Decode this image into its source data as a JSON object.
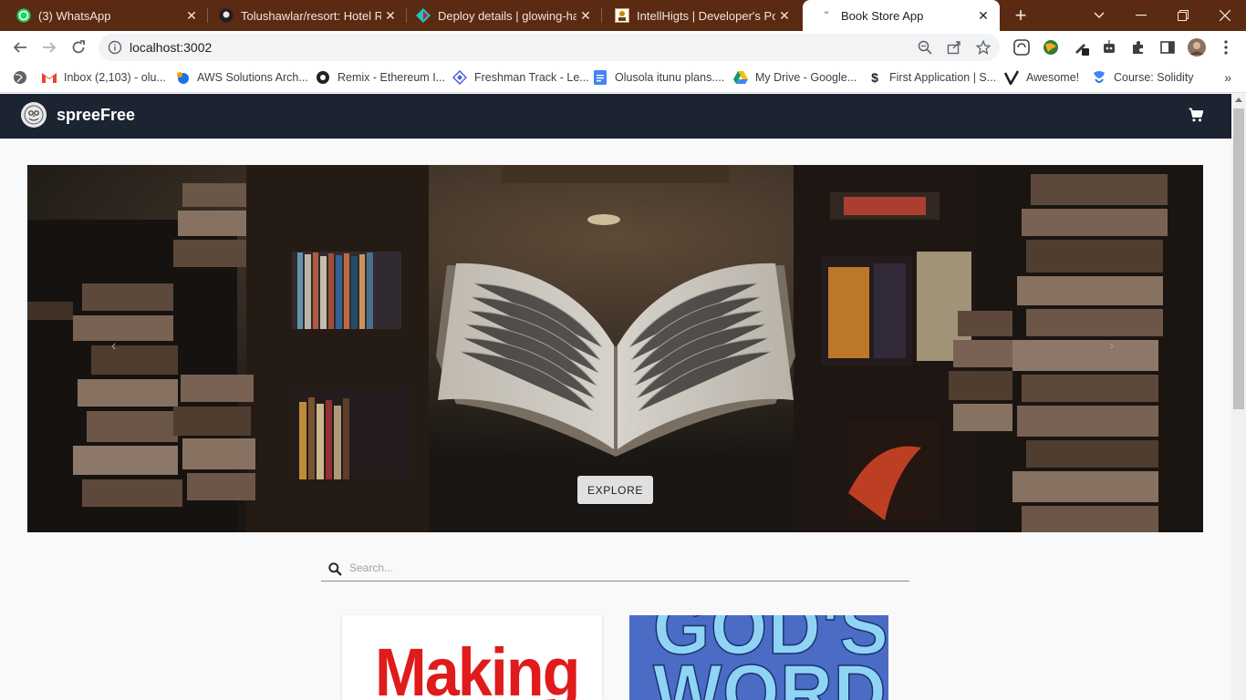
{
  "browser": {
    "tabs": [
      {
        "title": "(3) WhatsApp",
        "icon": "whatsapp-icon"
      },
      {
        "title": "Tolushawlar/resort: Hotel Res",
        "icon": "github-icon"
      },
      {
        "title": "Deploy details | glowing-hau",
        "icon": "netlify-icon"
      },
      {
        "title": "IntellHigts | Developer's Port",
        "icon": "portfolio-icon"
      },
      {
        "title": "Book Store App",
        "icon": "quote-icon",
        "active": true
      }
    ],
    "url": "localhost:3002",
    "bookmarks": [
      {
        "label": "Inbox (2,103) - olu...",
        "icon": "gmail-icon"
      },
      {
        "label": "AWS Solutions Arch...",
        "icon": "aws-icon"
      },
      {
        "label": "Remix - Ethereum I...",
        "icon": "remix-icon"
      },
      {
        "label": "Freshman Track - Le...",
        "icon": "freshman-icon"
      },
      {
        "label": "Olusola itunu plans....",
        "icon": "docs-icon"
      },
      {
        "label": "My Drive - Google...",
        "icon": "drive-icon"
      },
      {
        "label": "First Application | S...",
        "icon": "dollar-icon"
      },
      {
        "label": "Awesome!",
        "icon": "check-icon"
      },
      {
        "label": "Course: Solidity",
        "icon": "solidity-icon"
      }
    ],
    "bookmarks_more": "»"
  },
  "app": {
    "brand": "spreeFree",
    "hero": {
      "explore_label": "EXPLORE",
      "prev_label": "‹",
      "next_label": "›"
    },
    "search": {
      "placeholder": "Search..."
    },
    "books": [
      {
        "cover_text": "Making",
        "cover_color": "#e01b1b"
      },
      {
        "cover_text": "GOD'S WORD",
        "cover_color": "#4a6cc4"
      }
    ]
  },
  "colors": {
    "tab_strip": "#5b2a12",
    "appbar": "#1c2331",
    "explore_button": "#e0e0e0"
  }
}
